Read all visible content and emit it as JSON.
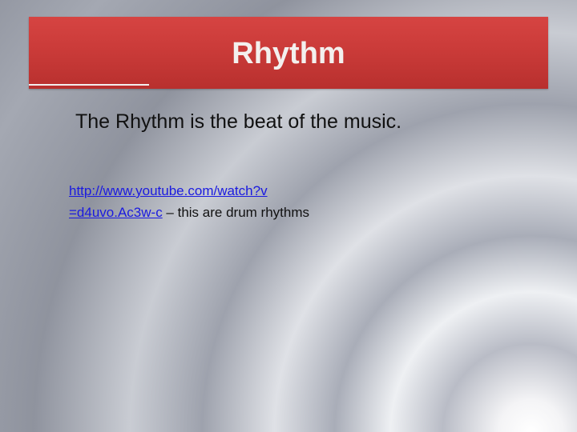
{
  "slide": {
    "title": "Rhythm",
    "subtitle": "The Rhythm is the beat of the music.",
    "link": {
      "line1": "http://www.youtube.com/watch?v",
      "line2": "=d4uvo.Ac3w-c"
    },
    "link_suffix": " – this are drum rhythms"
  },
  "colors": {
    "title_bar": "#c93a38",
    "title_text": "#f3f0ee",
    "link": "#1a1ae0",
    "body_text": "#111111"
  }
}
